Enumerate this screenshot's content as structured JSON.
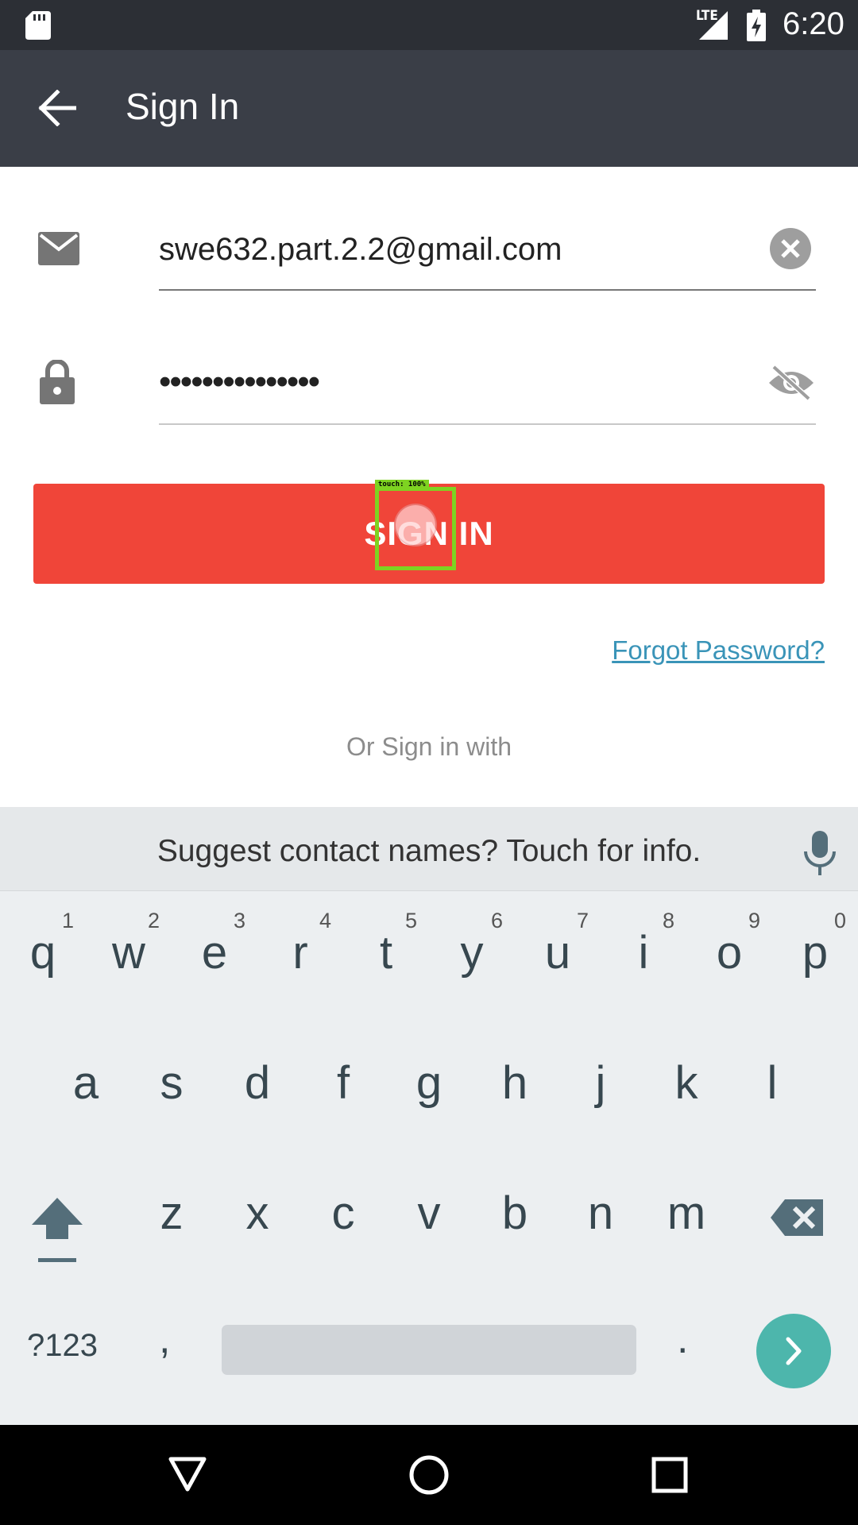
{
  "status_bar": {
    "time": "6:20",
    "network": "LTE",
    "icons": [
      "sd-card-icon",
      "signal-icon",
      "battery-charging-icon"
    ]
  },
  "app_bar": {
    "title": "Sign In",
    "back_icon": "arrow-back-icon"
  },
  "form": {
    "email_value": "swe632.part.2.2@gmail.com",
    "password_value": "•••••••••••••••",
    "email_icon": "envelope-icon",
    "password_icon": "lock-icon",
    "clear_icon": "clear-circle-icon",
    "visibility_icon": "eye-off-icon"
  },
  "signin_button": {
    "label": "SIGN IN",
    "color": "#f04539"
  },
  "touch_overlay": {
    "label": "touch: 100%"
  },
  "forgot_password": "Forgot Password?",
  "or_sign_in_with": "Or Sign in with",
  "keyboard": {
    "suggestion": "Suggest contact names? Touch for info.",
    "row1": [
      "q",
      "w",
      "e",
      "r",
      "t",
      "y",
      "u",
      "i",
      "o",
      "p"
    ],
    "row1_hints": [
      "1",
      "2",
      "3",
      "4",
      "5",
      "6",
      "7",
      "8",
      "9",
      "0"
    ],
    "row2": [
      "a",
      "s",
      "d",
      "f",
      "g",
      "h",
      "j",
      "k",
      "l"
    ],
    "row3": [
      "z",
      "x",
      "c",
      "v",
      "b",
      "n",
      "m"
    ],
    "symbols_key": "?123",
    "comma_key": ",",
    "period_key": "."
  },
  "colors": {
    "status_bar": "#2c2f35",
    "app_bar": "#3a3e47",
    "accent": "#f04539",
    "link": "#3a94b8",
    "enter_key": "#4db6ac"
  }
}
